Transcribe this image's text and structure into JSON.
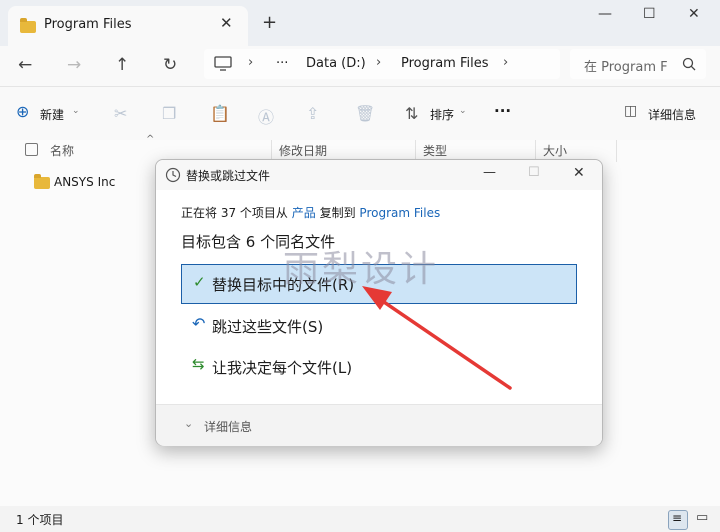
{
  "tab": {
    "title": "Program Files",
    "close": "✕",
    "new_tab": "+"
  },
  "window_controls": {
    "minimize": "—",
    "maximize": "☐",
    "close": "✕"
  },
  "address": {
    "ellipsis": "···",
    "crumbs": [
      "Data (D:)",
      "Program Files"
    ],
    "search_placeholder": "在 Program F"
  },
  "toolbar": {
    "new_label": "新建",
    "sort_label": "排序",
    "more": "···",
    "details_label": "详细信息"
  },
  "columns": {
    "name": "名称",
    "date": "修改日期",
    "type": "类型",
    "size": "大小"
  },
  "files": [
    {
      "name": "ANSYS Inc"
    }
  ],
  "status": {
    "count": "1 个项目"
  },
  "dialog": {
    "title": "替换或跳过文件",
    "info_prefix": "正在将 37 个项目从",
    "info_source": "产品",
    "info_mid": "复制到",
    "info_dest": "Program Files",
    "heading": "目标包含 6 个同名文件",
    "options": [
      {
        "label": "替换目标中的文件(R)"
      },
      {
        "label": "跳过这些文件(S)"
      },
      {
        "label": "让我决定每个文件(L)"
      }
    ],
    "more_details": "详细信息"
  },
  "watermark": "雨梨设计",
  "colors": {
    "accent": "#1a66b8",
    "selection_bg": "#cce4f7",
    "arrow": "#e53935",
    "folder": "#e8b83b"
  }
}
